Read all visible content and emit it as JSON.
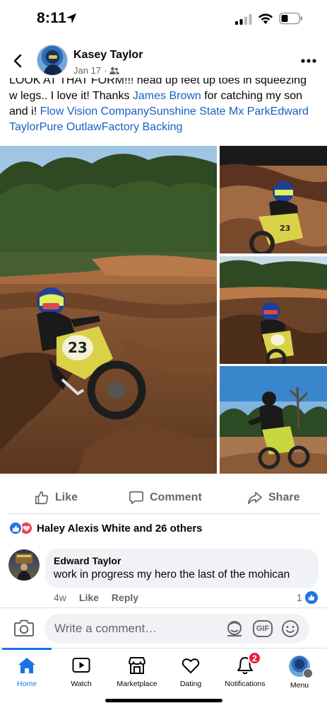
{
  "status_bar": {
    "time": "8:11"
  },
  "post": {
    "author": "Kasey Taylor",
    "date": "Jan 17",
    "meta_separator": "·",
    "audience_icon": "friends-icon",
    "caption_line_1": "LOOK AT THAT FORM!!! head up feet up toes in squeezing",
    "caption_line_2_start": "w legs.. I love it! Thanks ",
    "caption_mention": "James Brown",
    "caption_line_2_end": " for catching my son",
    "caption_line_3_start": "and i! ",
    "caption_tags": "Flow Vision CompanySunshine State Mx ParkEdward TaylorPure OutlawFactory Backing"
  },
  "actions": {
    "like": "Like",
    "comment": "Comment",
    "share": "Share"
  },
  "reactions": {
    "summary": "Haley Alexis White and 26 others",
    "types": [
      "like",
      "love"
    ]
  },
  "comment": {
    "author": "Edward Taylor",
    "text": "work in progress my hero the last of the mohican",
    "age": "4w",
    "like_label": "Like",
    "reply_label": "Reply",
    "like_count": "1"
  },
  "composer": {
    "placeholder": "Write a comment…",
    "gif_label": "GIF"
  },
  "tabbar": {
    "home": "Home",
    "watch": "Watch",
    "marketplace": "Marketplace",
    "dating": "Dating",
    "notifications": "Notifications",
    "notifications_badge": "2",
    "menu": "Menu"
  },
  "colors": {
    "accent": "#1b74e4",
    "link": "#1a5fc4",
    "badge": "#e41e3f",
    "love": "#f33e58",
    "secondary_text": "#65676b",
    "bubble": "#f0f2f5"
  }
}
